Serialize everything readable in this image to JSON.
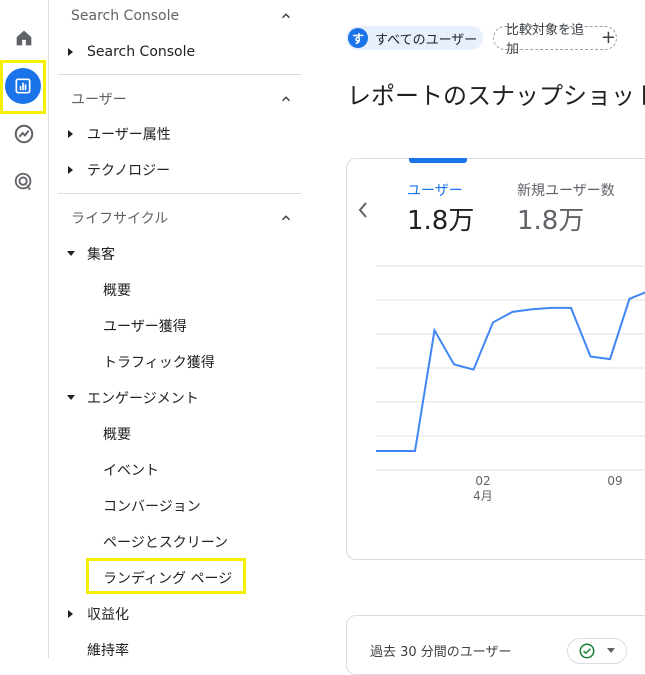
{
  "rail": {
    "items": [
      {
        "icon": "home-icon"
      },
      {
        "icon": "reports-icon",
        "active": true
      },
      {
        "icon": "explore-icon"
      },
      {
        "icon": "advertising-icon"
      }
    ]
  },
  "nav": {
    "sections": [
      {
        "label": "Search Console"
      },
      {
        "label": "ユーザー"
      },
      {
        "label": "ライフサイクル"
      }
    ],
    "search_console_item": "Search Console",
    "user_items": [
      "ユーザー属性",
      "テクノロジー"
    ],
    "acquisition": {
      "label": "集客",
      "items": [
        "概要",
        "ユーザー獲得",
        "トラフィック獲得"
      ]
    },
    "engagement": {
      "label": "エンゲージメント",
      "items": [
        "概要",
        "イベント",
        "コンバージョン",
        "ページとスクリーン",
        "ランディング ページ"
      ]
    },
    "monetization": "収益化",
    "retention": "維持率"
  },
  "main": {
    "user_chip": {
      "avatar": "す",
      "label": "すべてのユーザー"
    },
    "compare_chip": "比較対象を追加",
    "title": "レポートのスナップショット",
    "metrics": [
      {
        "label": "ユーザー",
        "value": "1.8万"
      },
      {
        "label": "新規ユーザー数",
        "value": "1.8万"
      }
    ],
    "realtime_label": "過去 30 分間のユーザー"
  },
  "chart_data": {
    "type": "line",
    "x_ticks": [
      {
        "label": "02",
        "sublabel": "4月"
      },
      {
        "label": "09"
      }
    ],
    "series": [
      {
        "values": [
          80,
          80,
          80,
          540,
          410,
          390,
          570,
          610,
          620,
          625,
          625,
          440,
          430,
          660,
          690
        ]
      }
    ],
    "ylim": [
      0,
      800
    ],
    "grid": true,
    "colors": {
      "line": "#4285f4",
      "grid": "#e0e0e0"
    }
  },
  "colors": {
    "accent": "#1a73e8",
    "highlight": "#f5ef00"
  }
}
